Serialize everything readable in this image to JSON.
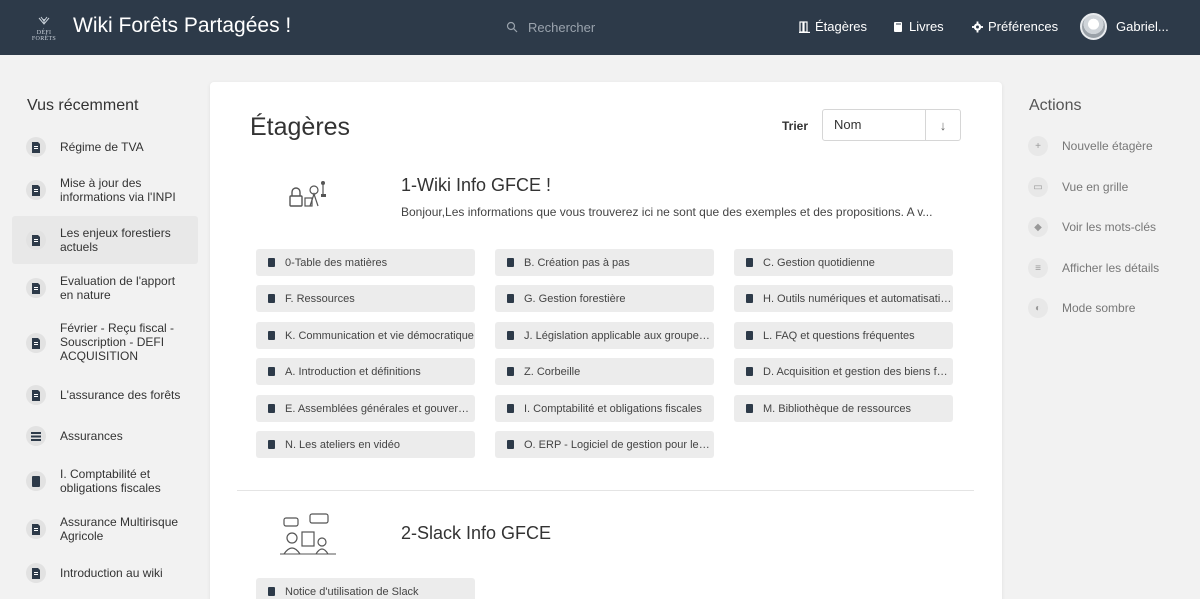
{
  "header": {
    "logo_text": "DÉFI FORÊTS",
    "site_title": "Wiki Forêts Partagées !",
    "search_placeholder": "Rechercher",
    "nav": [
      {
        "label": "Étagères",
        "icon": "shelves-icon"
      },
      {
        "label": "Livres",
        "icon": "books-icon"
      },
      {
        "label": "Préférences",
        "icon": "gear-icon"
      }
    ],
    "user_name": "Gabriel..."
  },
  "left": {
    "title": "Vus récemment",
    "items": [
      {
        "label": "Régime de TVA"
      },
      {
        "label": "Mise à jour des informations via l'INPI"
      },
      {
        "label": "Les enjeux forestiers actuels",
        "active": true
      },
      {
        "label": "Evaluation de l'apport en nature"
      },
      {
        "label": "Février - Reçu fiscal - Souscription - DEFI ACQUISITION"
      },
      {
        "label": "L'assurance des forêts"
      },
      {
        "label": "Assurances"
      },
      {
        "label": "I. Comptabilité et obligations fiscales"
      },
      {
        "label": "Assurance Multirisque Agricole"
      },
      {
        "label": "Introduction au wiki"
      }
    ]
  },
  "main": {
    "title": "Étagères",
    "sort_label": "Trier",
    "sort_value": "Nom",
    "sort_dir": "↓",
    "shelves": [
      {
        "name": "1-Wiki Info GFCE !",
        "description": "Bonjour,Les informations que vous trouverez ici ne sont que des exemples et des propositions. A v...",
        "books": [
          "0-Table des matières",
          "B. Création pas à pas",
          "C. Gestion quotidienne",
          "F. Ressources",
          "G. Gestion forestière",
          "H. Outils numériques et automatisations",
          "K. Communication et vie démocratique",
          "J. Législation applicable aux groupements",
          "L. FAQ et questions fréquentes",
          "A. Introduction et définitions",
          "Z. Corbeille",
          "D. Acquisition et gestion des biens forestiers",
          "E. Assemblées générales et gouvernance",
          "I. Comptabilité et obligations fiscales",
          "M. Bibliothèque de ressources",
          "N. Les ateliers en vidéo",
          "O. ERP - Logiciel de gestion pour les GFCE"
        ]
      },
      {
        "name": "2-Slack Info GFCE",
        "description": "",
        "books": [
          "Notice d'utilisation de Slack"
        ]
      }
    ]
  },
  "right": {
    "title": "Actions",
    "items": [
      {
        "label": "Nouvelle étagère",
        "icon": "plus-icon"
      },
      {
        "label": "Vue en grille",
        "icon": "grid-icon"
      },
      {
        "label": "Voir les mots-clés",
        "icon": "tag-icon"
      },
      {
        "label": "Afficher les détails",
        "icon": "details-icon"
      },
      {
        "label": "Mode sombre",
        "icon": "moon-icon"
      }
    ]
  },
  "colors": {
    "header_bg": "#2d3a49",
    "page_bg": "#f2f2f2",
    "chip_bg": "#ececec",
    "book_icon": "#2d3a49"
  }
}
